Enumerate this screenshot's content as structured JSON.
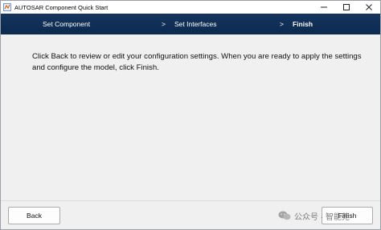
{
  "window": {
    "title": "AUTOSAR Component Quick Start"
  },
  "steps": {
    "items": [
      {
        "label": "Set Component"
      },
      {
        "label": "Set Interfaces"
      },
      {
        "label": "Finish"
      }
    ],
    "separator": ">",
    "active_index": 2
  },
  "content": {
    "message": "Click Back to review or edit your configuration settings. When you are ready to apply the settings and configure the model, click Finish."
  },
  "footer": {
    "back_label": "Back",
    "finish_label": "Finish",
    "watermark_text": "公众号 · 智能苑"
  },
  "icons": {
    "app": "simulink-app-icon",
    "minimize": "minimize-icon",
    "maximize": "maximize-icon",
    "close": "close-icon",
    "watermark": "wechat-icon"
  },
  "colors": {
    "banner": "#14355e",
    "background": "#f0f0f0"
  }
}
